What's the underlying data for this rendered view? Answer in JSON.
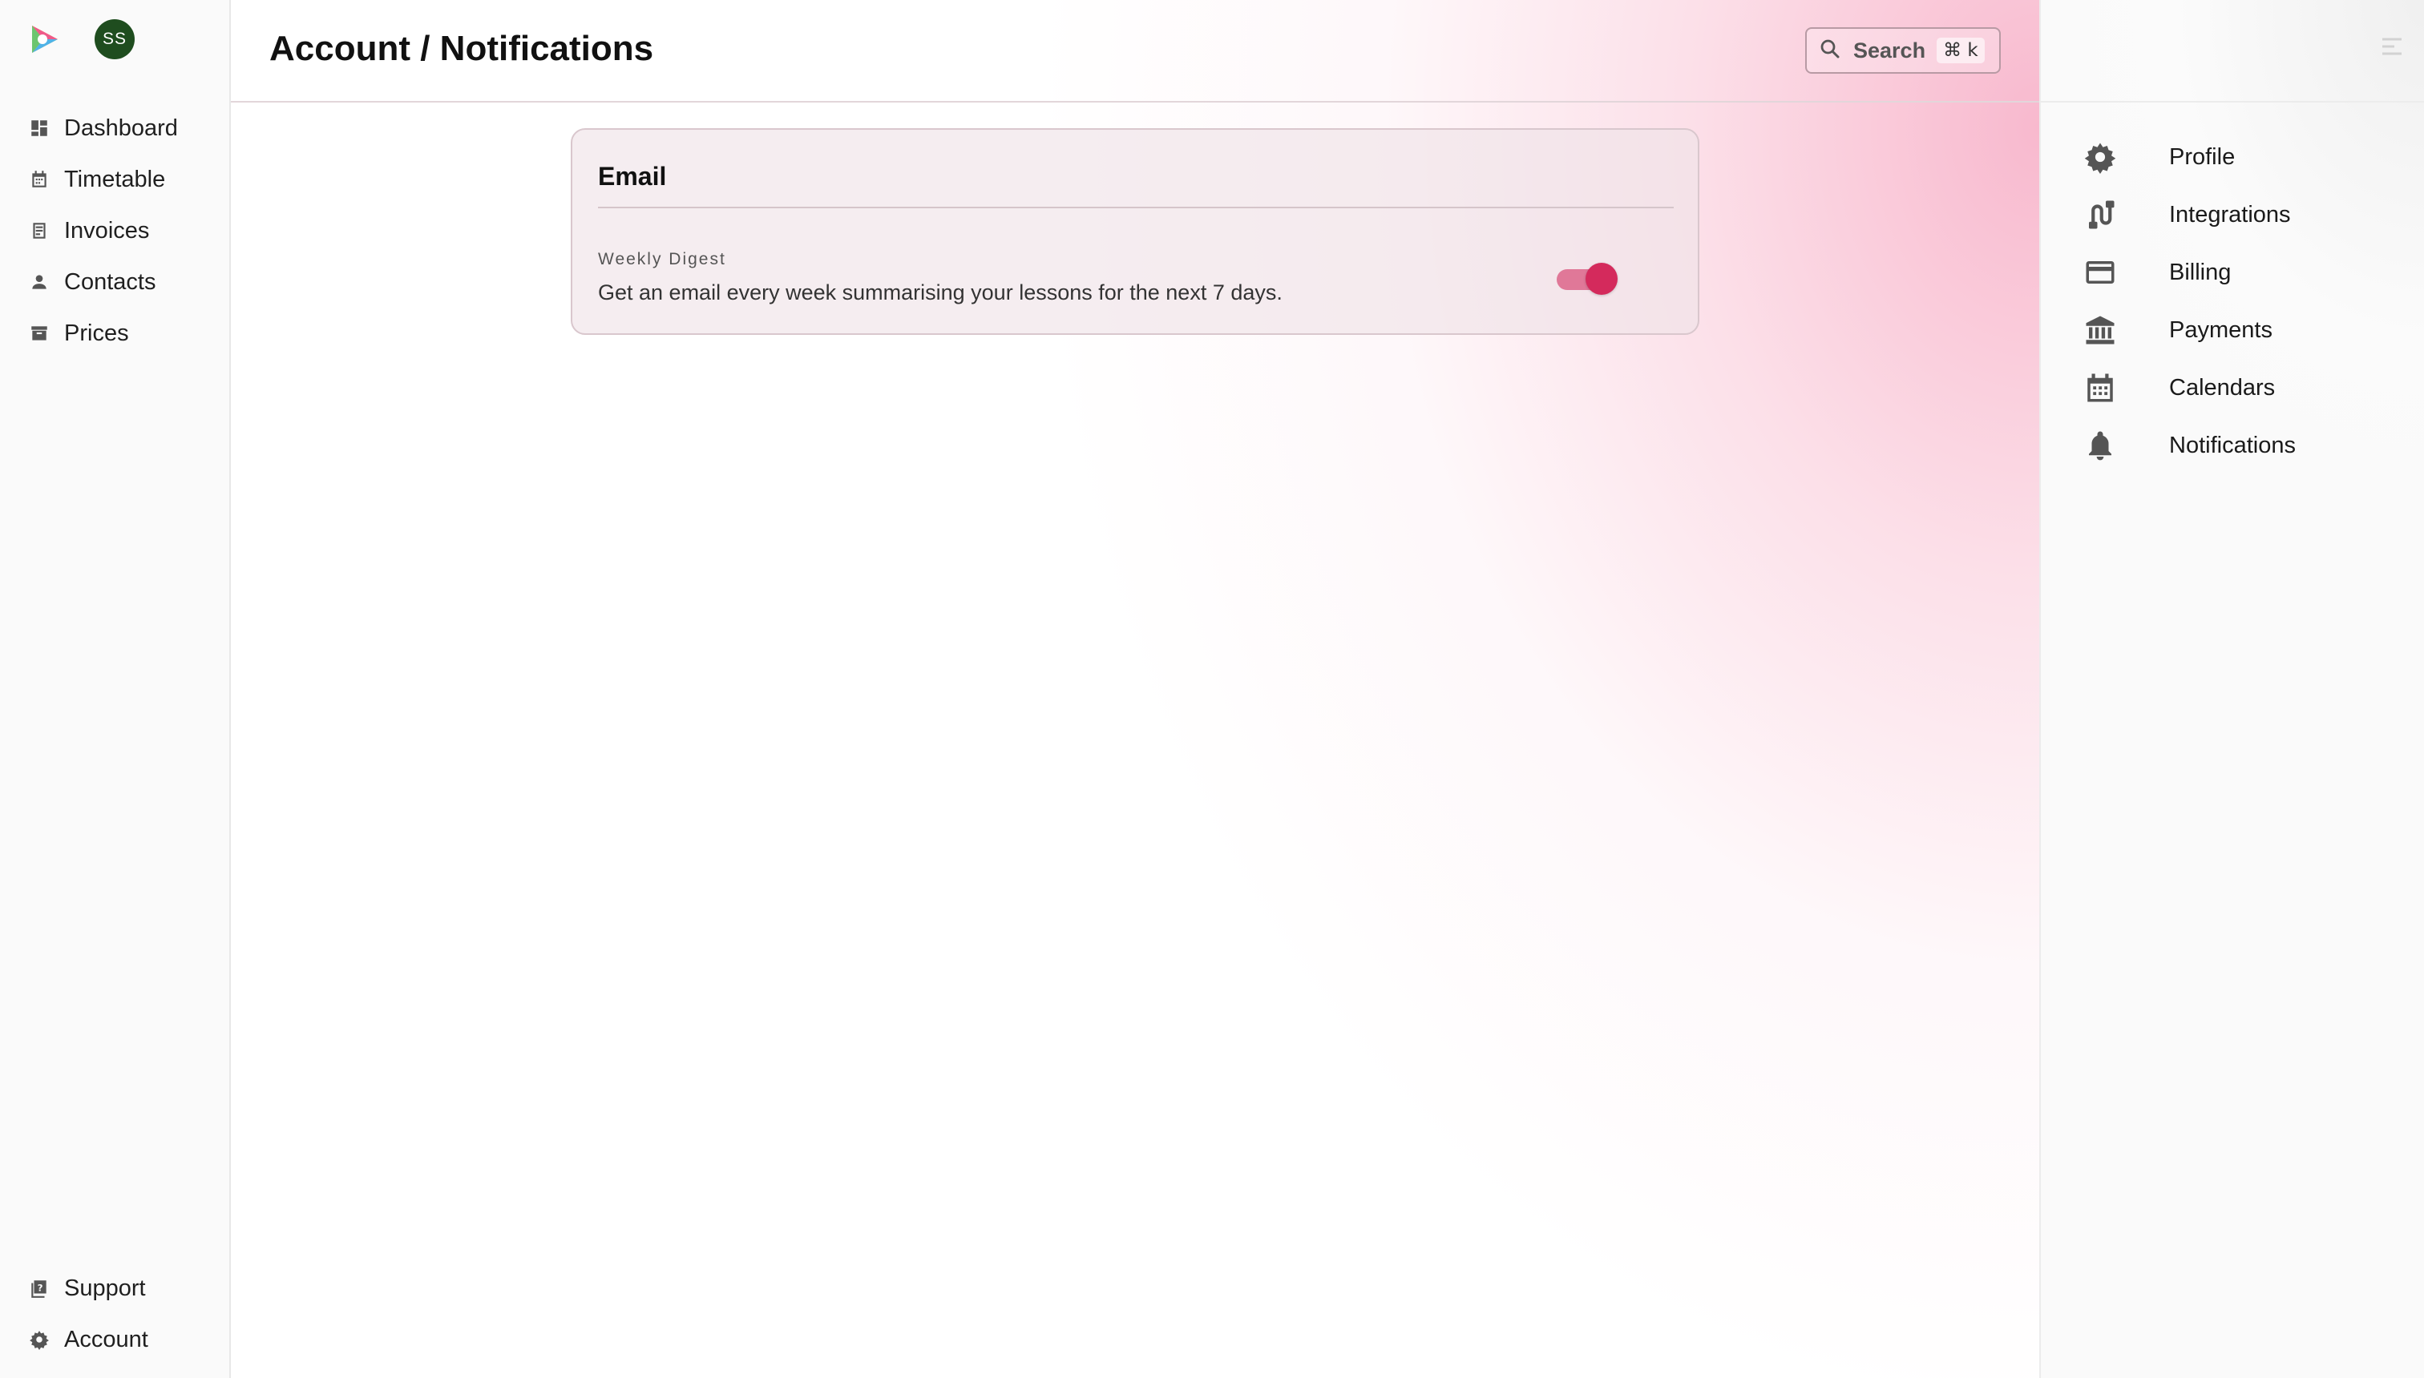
{
  "sidebar": {
    "avatar_initials": "SS",
    "items": [
      {
        "label": "Dashboard",
        "icon": "dashboard-icon"
      },
      {
        "label": "Timetable",
        "icon": "calendar-icon"
      },
      {
        "label": "Invoices",
        "icon": "invoice-icon"
      },
      {
        "label": "Contacts",
        "icon": "person-icon"
      },
      {
        "label": "Prices",
        "icon": "archive-icon"
      }
    ],
    "bottom_items": [
      {
        "label": "Support",
        "icon": "help-book-icon"
      },
      {
        "label": "Account",
        "icon": "gear-icon"
      }
    ]
  },
  "header": {
    "title": "Account / Notifications",
    "search_label": "Search",
    "search_shortcut": "⌘ k"
  },
  "email_card": {
    "title": "Email",
    "setting": {
      "label": "Weekly Digest",
      "description": "Get an email every week summarising your lessons for the next 7 days.",
      "enabled": true
    }
  },
  "account_nav": {
    "items": [
      {
        "label": "Profile",
        "icon": "gear-icon"
      },
      {
        "label": "Integrations",
        "icon": "integrations-icon"
      },
      {
        "label": "Billing",
        "icon": "credit-card-icon"
      },
      {
        "label": "Payments",
        "icon": "bank-icon"
      },
      {
        "label": "Calendars",
        "icon": "calendar-icon"
      },
      {
        "label": "Notifications",
        "icon": "bell-icon"
      }
    ]
  },
  "colors": {
    "accent": "#d42a5c",
    "accent_light": "#e07898",
    "avatar_bg": "#1f4d1f"
  }
}
